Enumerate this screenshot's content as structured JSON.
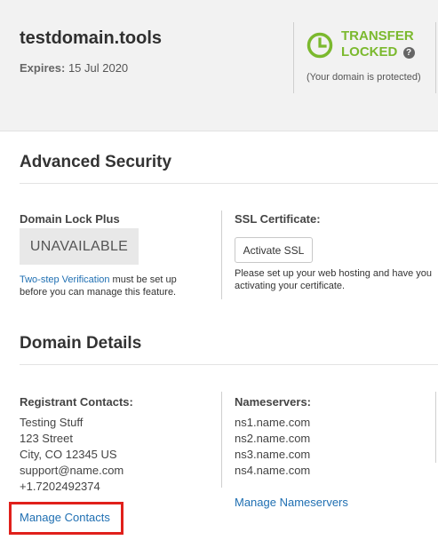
{
  "header": {
    "domain": "testdomain.tools",
    "expires_label": "Expires:",
    "expires_value": "15 Jul 2020",
    "lock_title_line1": "TRANSFER",
    "lock_title_line2": "LOCKED",
    "help_glyph": "?",
    "lock_note": "(Your domain is protected)",
    "lock_color": "#7bb92e"
  },
  "advanced_security": {
    "title": "Advanced Security",
    "domain_lock": {
      "label": "Domain Lock Plus",
      "status": "UNAVAILABLE",
      "note_link": "Two-step Verification",
      "note_rest1": " must be set up",
      "note_rest2": "before you can manage this feature."
    },
    "ssl": {
      "label": "SSL Certificate:",
      "button": "Activate SSL",
      "note_line1": "Please set up your web hosting and have you",
      "note_line2": "activating your certificate."
    }
  },
  "domain_details": {
    "title": "Domain Details",
    "registrant": {
      "label": "Registrant Contacts:",
      "lines": [
        "Testing Stuff",
        "123 Street",
        "City, CO 12345 US",
        "support@name.com",
        "+1.7202492374"
      ],
      "manage_link": "Manage Contacts"
    },
    "nameservers": {
      "label": "Nameservers:",
      "lines": [
        "ns1.name.com",
        "ns2.name.com",
        "ns3.name.com",
        "ns4.name.com"
      ],
      "manage_link": "Manage Nameservers"
    }
  },
  "colors": {
    "link": "#1f6fb2",
    "highlight": "#e0201b"
  }
}
